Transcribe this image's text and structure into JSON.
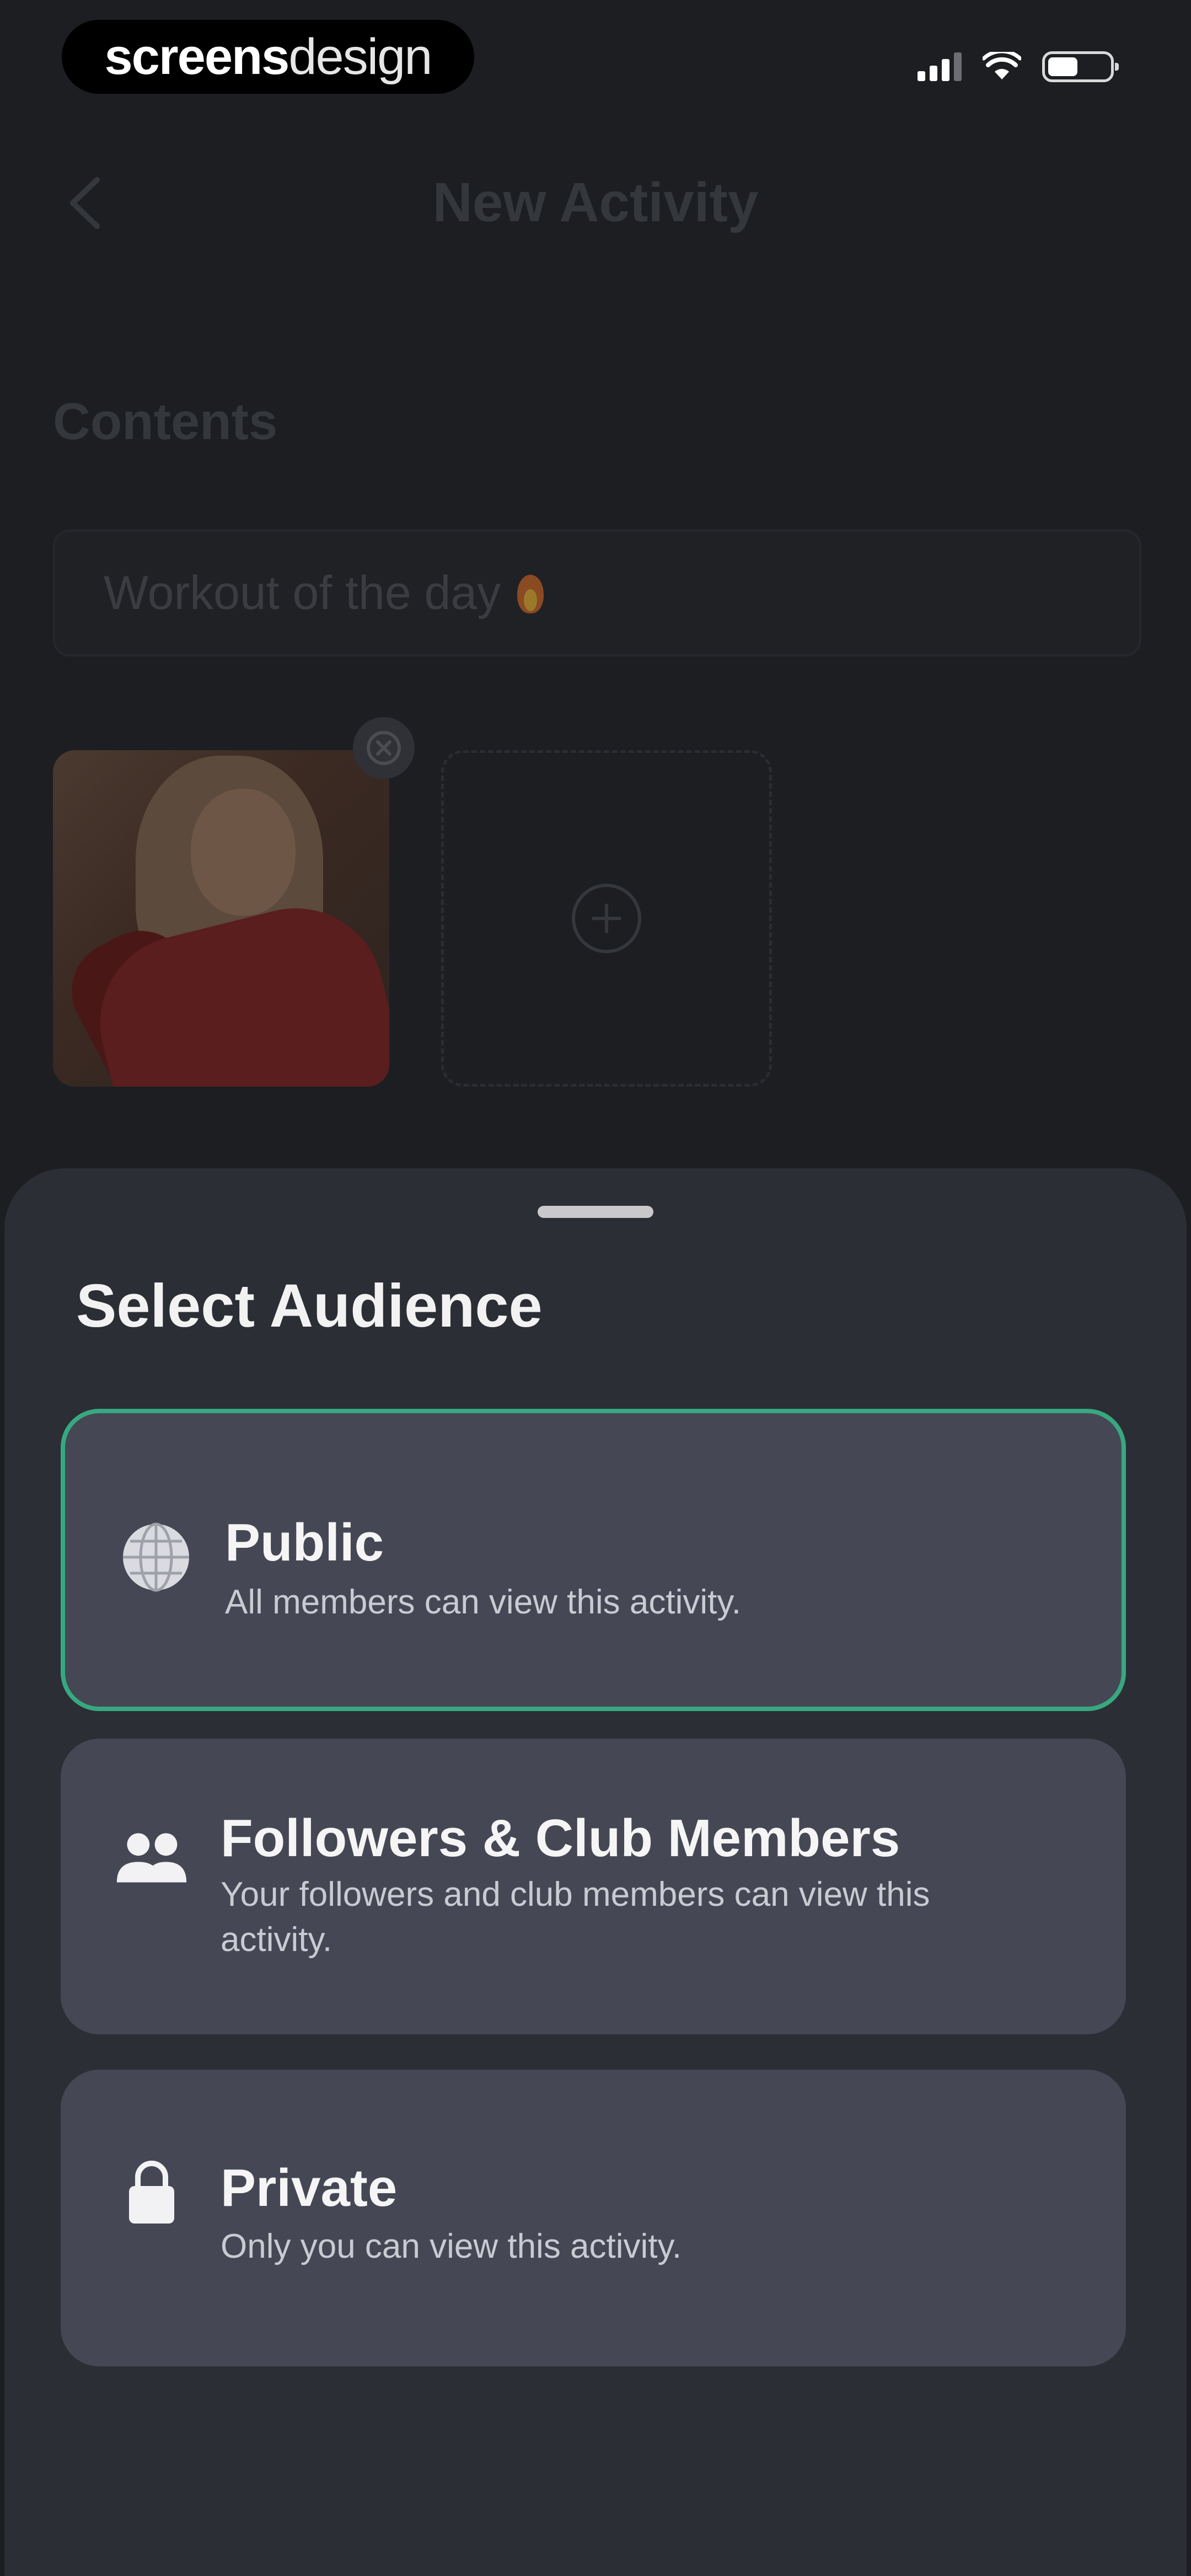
{
  "status_bar": {
    "watermark_bold": "screens",
    "watermark_regular": "design",
    "icons": [
      "signal-icon",
      "wifi-icon",
      "battery-icon"
    ]
  },
  "background_page": {
    "nav_title": "New Activity",
    "section_title": "Contents",
    "content_input_value": "Workout of the day",
    "content_input_emoji": "fire-icon",
    "icons": [
      "chevron-left-icon",
      "remove-icon",
      "add-circle-icon"
    ]
  },
  "sheet": {
    "title": "Select Audience",
    "selected_option": "public",
    "accent_color": "#37a880",
    "options": [
      {
        "id": "public",
        "label": "Public",
        "description": "All members can view this activity.",
        "icon": "globe-icon"
      },
      {
        "id": "followers",
        "label": "Followers & Club Members",
        "description": "Your followers and club members can view this activity.",
        "icon": "people-icon"
      },
      {
        "id": "private",
        "label": "Private",
        "description": "Only you can view this activity.",
        "icon": "lock-icon"
      }
    ]
  }
}
